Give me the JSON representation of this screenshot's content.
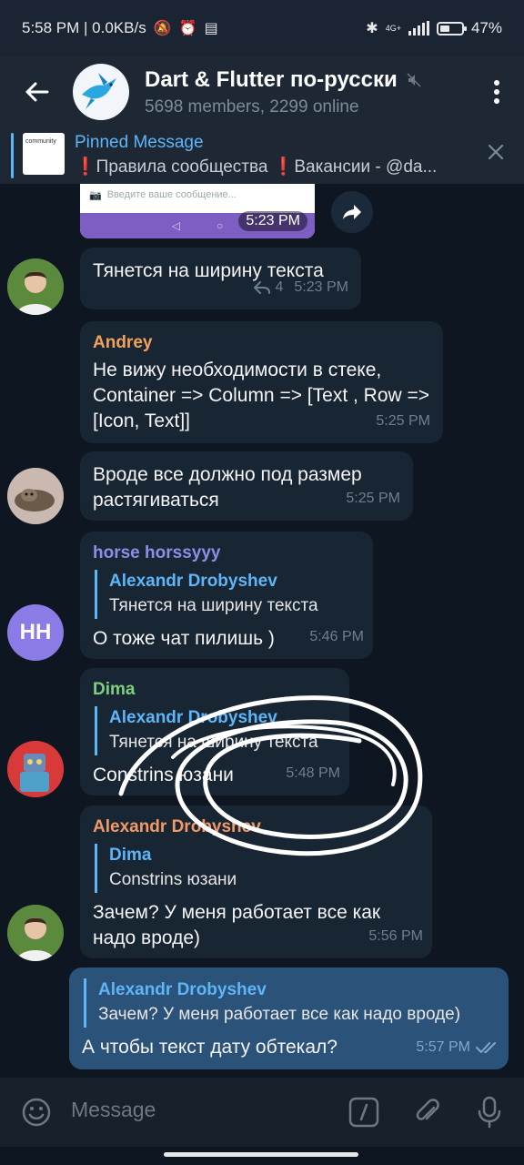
{
  "status_bar": {
    "time_speed": "5:58 PM | 0.0KB/s",
    "network": "4G+",
    "battery": "47%",
    "battery_level": 0.47,
    "icons": [
      "mute-icon",
      "alarm-icon",
      "notification-icon",
      "bluetooth-icon",
      "signal-icon",
      "battery-icon"
    ]
  },
  "header": {
    "title": "Dart & Flutter по-русски",
    "subtitle": "5698 members, 2299 online",
    "muted": true
  },
  "pinned": {
    "label": "Pinned Message",
    "text": "❗Правила сообщества ❗Вакансии - @da...",
    "thumb_text": "community"
  },
  "prev_message": {
    "input_placeholder": "Введите ваше сообщение...",
    "time": "5:23 PM"
  },
  "messages": [
    {
      "text": "Тянется на ширину текста",
      "replies": "4",
      "time": "5:23 PM"
    },
    {
      "sender": "Andrey",
      "sender_color": "#f2a35b",
      "text": "Не вижу необходимости в стеке, Container => Column => [Text , Row => [Icon, Text]]",
      "time": "5:25 PM"
    },
    {
      "text": "Вроде все должно под размер растягиваться",
      "time": "5:25 PM"
    },
    {
      "sender": "horse horssyyy",
      "sender_color": "#8b8fe6",
      "avatar_initials": "HH",
      "reply_name": "Alexandr Drobyshev",
      "reply_text": "Тянется на ширину текста",
      "text": "О тоже чат пилишь )",
      "time": "5:46 PM"
    },
    {
      "sender": "Dima",
      "sender_color": "#7fd07e",
      "reply_name": "Alexandr Drobyshev",
      "reply_text": "Тянется на ширину текста",
      "text": "Constrins юзани",
      "time": "5:48 PM"
    },
    {
      "sender": "Alexandr Drobyshev",
      "sender_color": "#f29a67",
      "reply_name": "Dima",
      "reply_text": "Constrins юзани",
      "text": "Зачем? У меня работает все как надо вроде)",
      "time": "5:56 PM"
    },
    {
      "reply_name": "Alexandr Drobyshev",
      "reply_text": "Зачем? У меня работает все как надо вроде)",
      "text": "А чтобы текст дату обтекал?",
      "time": "5:57 PM"
    }
  ],
  "input": {
    "placeholder": "Message"
  },
  "colors": {
    "background": "#0e1621",
    "incoming_bubble": "#182533",
    "outgoing_bubble": "#2b5278",
    "accent": "#5eb5f7"
  }
}
